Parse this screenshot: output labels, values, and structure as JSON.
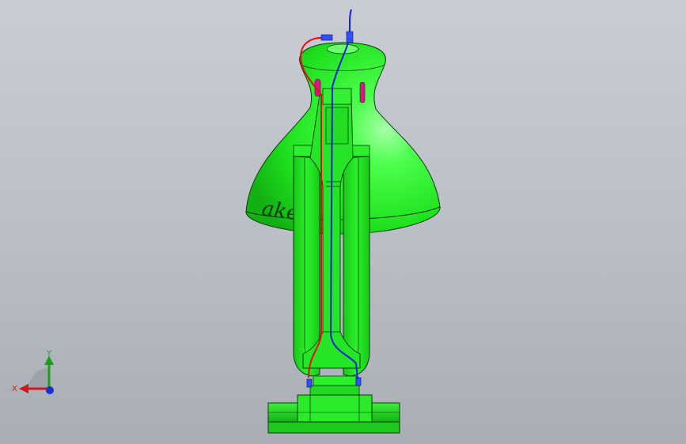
{
  "viewport": {
    "background_top": "#c9cdd3",
    "background_bottom": "#a9aeb5"
  },
  "model": {
    "part_color": "#22ee22",
    "edge_color": "#0a3a0a",
    "wire_red": "#e01010",
    "wire_blue": "#1020e0",
    "shade_text": "aker"
  },
  "triad": {
    "x_label": "X",
    "y_label": "Y",
    "x_color": "#d01818",
    "y_color": "#18a018",
    "z_color": "#1830d0"
  }
}
